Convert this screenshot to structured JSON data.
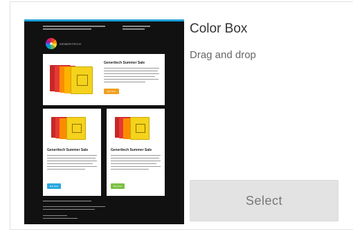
{
  "template": {
    "name": "Color Box",
    "description": "Drag and drop",
    "select_label": "Select"
  },
  "preview": {
    "brand_name": "GENERITECH",
    "panels": [
      {
        "title": "Generitech Summer Sale",
        "button": "Buy Now",
        "button_color": "#f0a020"
      },
      {
        "title": "Generitech Summer Sale",
        "button": "Buy Now",
        "button_color": "#2aa8e0"
      },
      {
        "title": "Generitech Summer Sale",
        "button": "Buy Now",
        "button_color": "#7cc043"
      }
    ],
    "footer_links": "Privacy & Policy | Terms of Service | Unsubscribe",
    "accent_color": "#1ea0d8",
    "background_color": "#111111"
  },
  "icons": [
    "color-wheel-icon"
  ]
}
